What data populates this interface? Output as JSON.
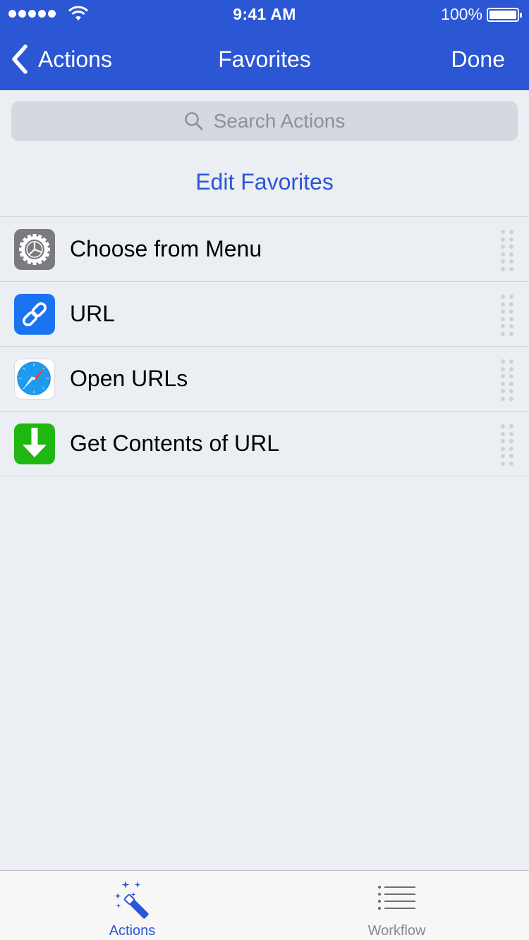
{
  "status_bar": {
    "time": "9:41 AM",
    "battery_percent": "100%",
    "signal_strength": 5,
    "battery_level": 1.0
  },
  "nav": {
    "back_label": "Actions",
    "title": "Favorites",
    "done_label": "Done"
  },
  "search": {
    "placeholder": "Search Actions"
  },
  "edit_favorites_label": "Edit Favorites",
  "actions": [
    {
      "label": "Choose from Menu",
      "icon": "gear-icon",
      "icon_color": "#7a7a7f"
    },
    {
      "label": "URL",
      "icon": "link-icon",
      "icon_color": "#1a73f0"
    },
    {
      "label": "Open URLs",
      "icon": "safari-compass-icon",
      "icon_color": "#1e9bf0"
    },
    {
      "label": "Get Contents of URL",
      "icon": "download-arrow-icon",
      "icon_color": "#1fb811"
    }
  ],
  "tabs": [
    {
      "label": "Actions",
      "icon": "magic-wand-icon",
      "active": true
    },
    {
      "label": "Workflow",
      "icon": "list-icon",
      "active": false
    }
  ],
  "colors": {
    "accent": "#2b56d4",
    "background": "#ebeef3",
    "inactive_tab": "#8a8a8f"
  }
}
